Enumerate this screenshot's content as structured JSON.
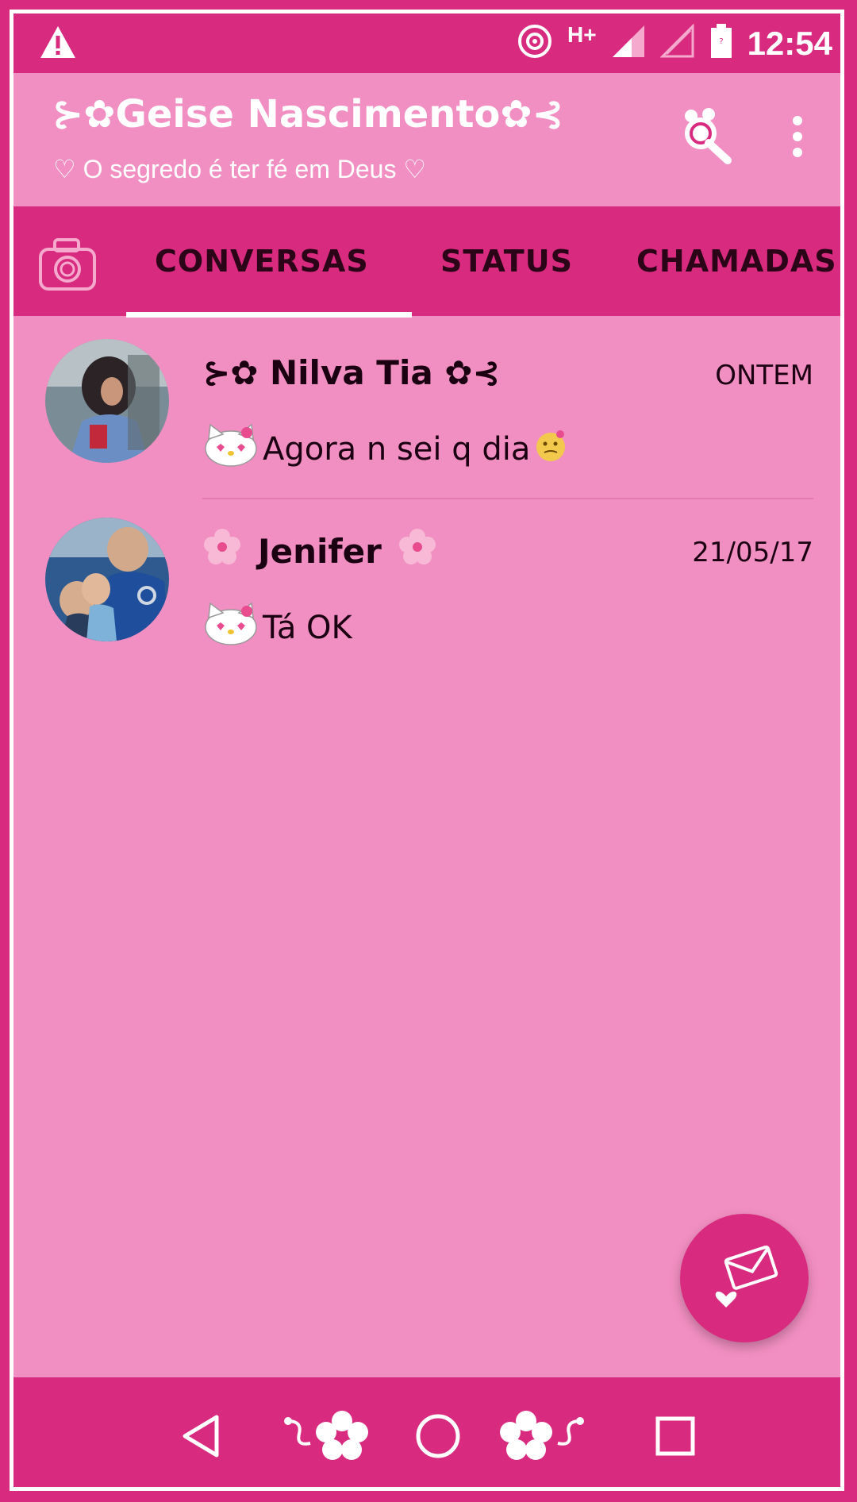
{
  "status_bar": {
    "network": "H+",
    "time": "12:54",
    "icons": [
      "warning-icon",
      "data-saver-icon",
      "signal-icon",
      "signal-empty-icon",
      "battery-icon"
    ]
  },
  "app_bar": {
    "title": "⊱✿Geise Nascimento✿⊰",
    "subtitle": "♡ O segredo é ter fé em Deus ♡",
    "icons": [
      "search-icon",
      "more-vert-icon"
    ]
  },
  "tabs": [
    {
      "label": "CONVERSAS",
      "selected": true
    },
    {
      "label": "STATUS",
      "selected": false
    },
    {
      "label": "CHAMADAS",
      "selected": false
    }
  ],
  "chats": [
    {
      "name": "⊱✿ Nilva Tia ✿⊰",
      "time": "ONTEM",
      "message": "Agora n sei q dia"
    },
    {
      "name": "Jenifer",
      "time": "21/05/17",
      "message": "Tá OK"
    }
  ],
  "navigation": {
    "icons": [
      "back-icon",
      "flower-left-icon",
      "home-icon",
      "flower-right-icon",
      "recents-icon"
    ]
  },
  "colors": {
    "primary": "#d82a7e",
    "background": "#f28fc2",
    "text_dark": "#1a0010"
  }
}
